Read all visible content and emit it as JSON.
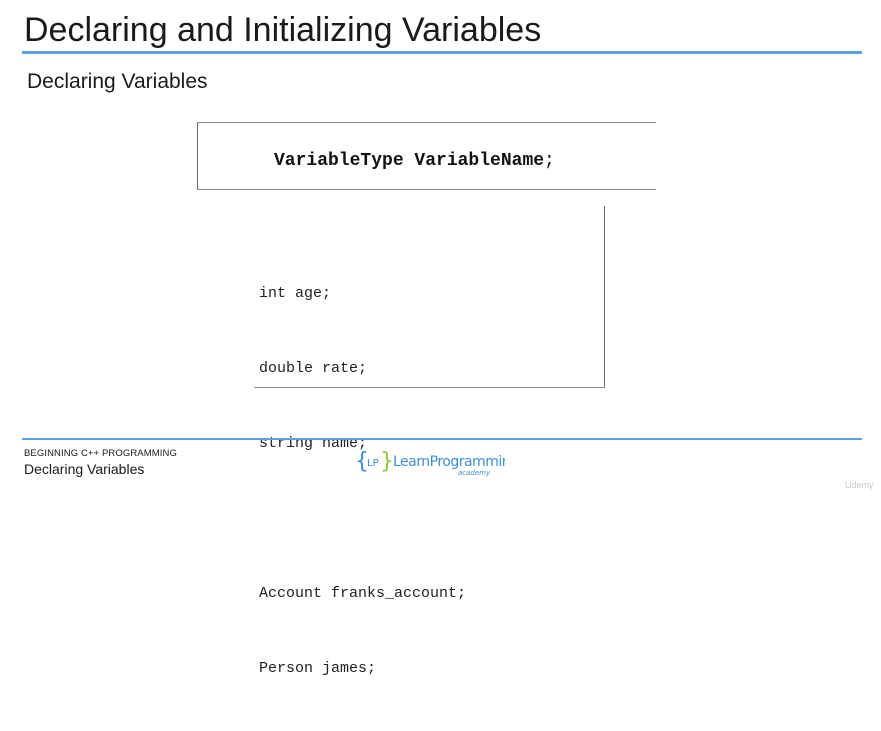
{
  "slide": {
    "title": "Declaring and Initializing Variables",
    "subtitle": "Declaring Variables"
  },
  "syntax": {
    "type_part": "VariableType VariableName",
    "terminator": ";"
  },
  "code_example": {
    "lines": [
      "int age;",
      "double rate;",
      "string name;",
      "",
      "Account franks_account;",
      "Person james;"
    ]
  },
  "footer": {
    "course": "BEGINNING C++ PROGRAMMING",
    "section": "Declaring Variables",
    "logo_text": "LearnProgramming",
    "logo_subtext": "academy",
    "logo_initials": "LP",
    "watermark": "Udemy"
  },
  "colors": {
    "accent_rule": "#5ba3e0",
    "logo_blue": "#3c8fd4",
    "logo_green": "#8dc63f"
  }
}
